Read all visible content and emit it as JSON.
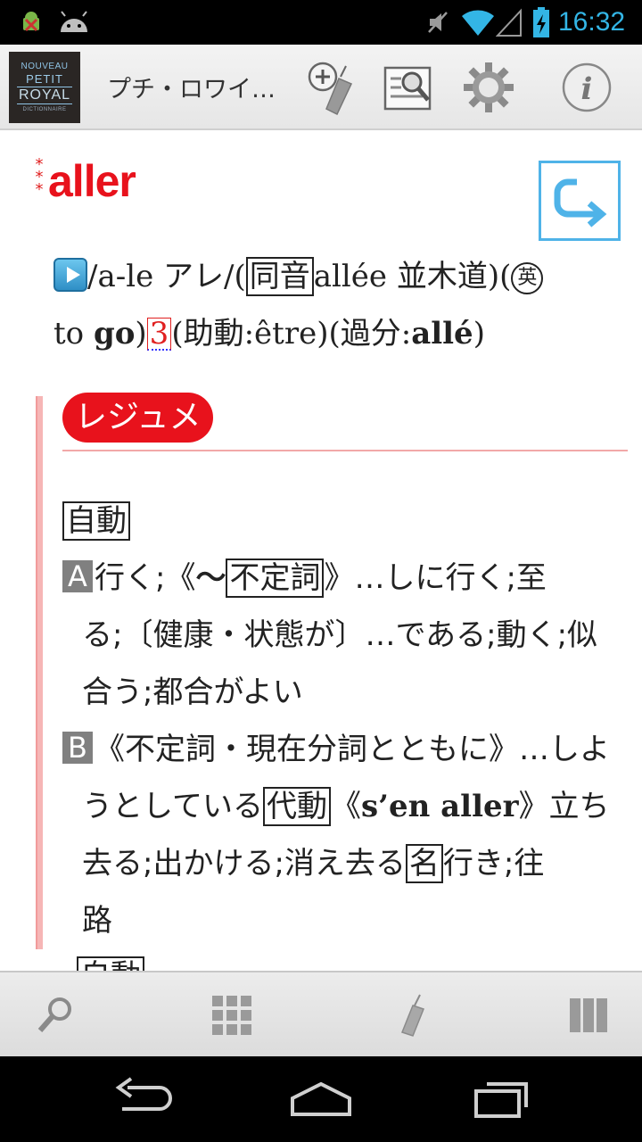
{
  "status_bar": {
    "time": "16:32",
    "icons": [
      "android-debug-icon",
      "android-icon",
      "mute-icon",
      "wifi-icon",
      "signal-icon",
      "battery-charging-icon"
    ]
  },
  "action_bar": {
    "logo": {
      "line1": "NOUVEAU",
      "line2": "PETIT",
      "line3": "ROYAL",
      "line4": "DICTIONNAIRE"
    },
    "title": "プチ・ロワイ…",
    "buttons": [
      "add-bookmark-icon",
      "search-page-icon",
      "gear-icon",
      "info-icon"
    ]
  },
  "entry": {
    "stars": "***",
    "headword": "aller",
    "pron": {
      "phon": "/a-le アレ/(",
      "homophone_tag": "同音",
      "homophone": "allée 並木道)(",
      "english_mark": "英",
      "english_pre": "to ",
      "english_word": "go",
      "english_close": ")",
      "conj_num": "3",
      "aux": "(助動:être)(過分:",
      "pp": "allé",
      "pp_close": ")"
    },
    "summary_label": "レジュメ",
    "pos1": "自動",
    "a": {
      "letter": "A",
      "l1_pre": "行く;《",
      "l1_tilde": "〜",
      "l1_tag": "不定詞",
      "l1_post": "》…しに行く;至",
      "l2": "る;〔健康・状態が〕…である;動く;似",
      "l3": "合う;都合がよい"
    },
    "b": {
      "letter": "B",
      "l1": "《不定詞・現在分詞とともに》…しよ",
      "l2_pre": "うとしている",
      "l2_tag": "代動",
      "l2_open": "《",
      "l2_bold": "s’en aller",
      "l2_post": "》立ち",
      "l3_pre": "去る;出かける;消え去る",
      "l3_tag": "名",
      "l3_post": "行き;往",
      "l4": "路"
    },
    "cut_line": "自動"
  },
  "bottom_bar": {
    "buttons": [
      "search-icon",
      "grid-icon",
      "bookmark-icon",
      "columns-icon"
    ]
  },
  "nav_bar": {
    "buttons": [
      "back-icon",
      "home-icon",
      "recent-apps-icon"
    ]
  }
}
